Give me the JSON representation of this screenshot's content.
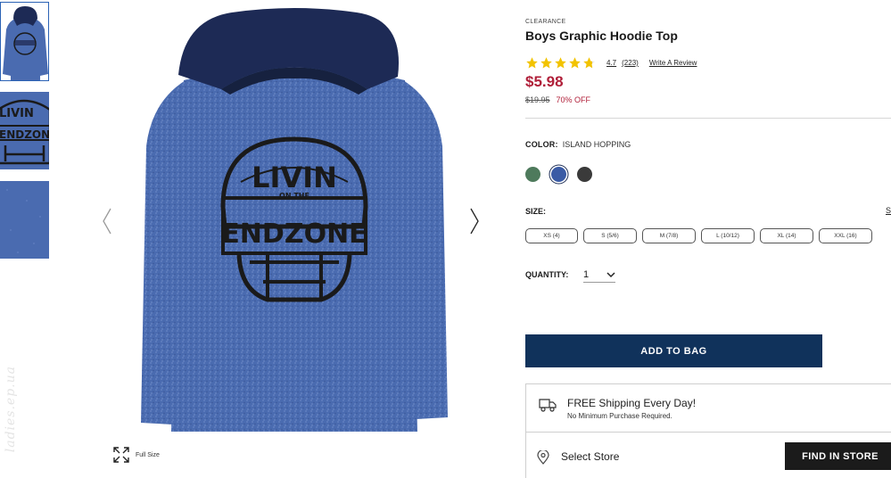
{
  "product": {
    "kicker": "CLEARANCE",
    "title": "Boys Graphic Hoodie Top",
    "rating": "4.7",
    "rating_count": "(223)",
    "rating_stars": 4.7,
    "write_review": "Write A Review",
    "price": "$5.98",
    "original_price": "$19.95",
    "discount": "70% OFF"
  },
  "gallery": {
    "full_size_label": "Full Size",
    "watermark": "ladies.ep.ua"
  },
  "graphic_text": {
    "line1": "LIVIN",
    "line2": "ON THE",
    "line3": "ENDZONE"
  },
  "color": {
    "label": "COLOR:",
    "selected": "ISLAND HOPPING",
    "swatches": [
      {
        "name": "green-heather",
        "hex": "#4e7a5c"
      },
      {
        "name": "island-hopping",
        "hex": "#3a5ba5"
      },
      {
        "name": "charcoal",
        "hex": "#3a3a3a"
      }
    ]
  },
  "size": {
    "label": "SIZE:",
    "guide_label": "S",
    "options": [
      "XS (4)",
      "S (5/6)",
      "M (7/8)",
      "L (10/12)",
      "XL (14)",
      "XXL (16)"
    ]
  },
  "quantity": {
    "label": "QUANTITY:",
    "value": "1"
  },
  "actions": {
    "add_to_bag": "ADD TO BAG",
    "find_in_store": "FIND IN STORE"
  },
  "shipping": {
    "title": "FREE Shipping Every Day!",
    "subtitle": "No Minimum Purchase Required.",
    "select_store": "Select Store"
  },
  "colors": {
    "shirt": "#4a6bb0",
    "hood": "#1d2a55",
    "price_red": "#b01f39",
    "navy_button": "#10325b",
    "star_gold": "#f2c300"
  }
}
